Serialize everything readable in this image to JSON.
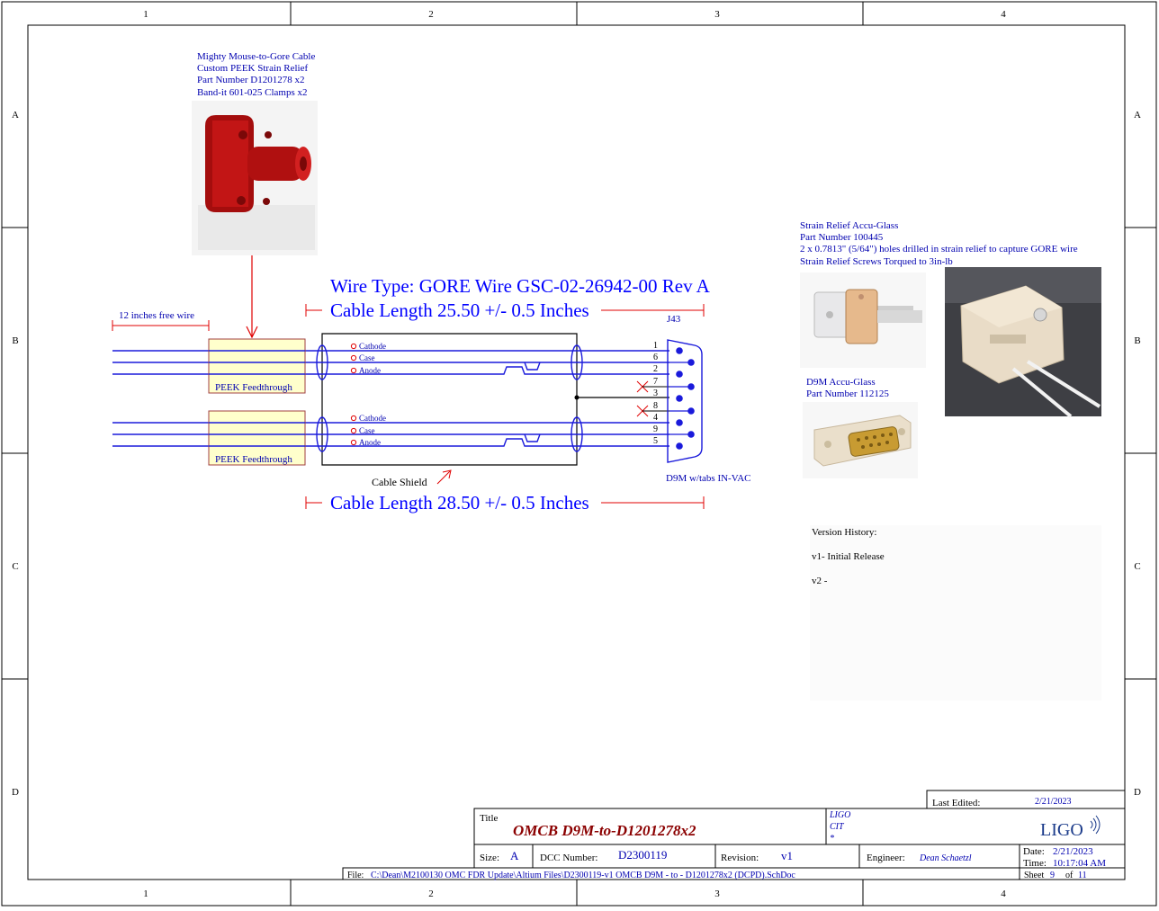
{
  "frame": {
    "columns": [
      "1",
      "2",
      "3",
      "4"
    ],
    "rows": [
      "A",
      "B",
      "C",
      "D"
    ]
  },
  "strain_relief_note": {
    "lines": [
      "Mighty Mouse-to-Gore Cable",
      "Custom PEEK Strain Relief",
      "Part Number D1201278 x2",
      "Band-it 601-025 Clamps x2"
    ]
  },
  "free_wire_label": "12 inches free wire",
  "wire_type": "Wire Type: GORE Wire GSC-02-26942-00 Rev A",
  "cable_length_top": "Cable Length 25.50 +/- 0.5 Inches",
  "cable_length_bottom": "Cable Length 28.50 +/- 0.5 Inches",
  "feedthroughs": [
    {
      "label": "PEEK Feedthrough",
      "wires": [
        "Cathode",
        "Case",
        "Anode"
      ]
    },
    {
      "label": "PEEK Feedthrough",
      "wires": [
        "Cathode",
        "Case",
        "Anode"
      ]
    }
  ],
  "cable_shield_label": "Cable Shield",
  "connector": {
    "ref": "J43",
    "pins": [
      "1",
      "6",
      "2",
      "7",
      "3",
      "8",
      "4",
      "9",
      "5"
    ],
    "name": "D9M w/tabs IN-VAC"
  },
  "accu_glass_note": {
    "lines": [
      "Strain Relief Accu-Glass",
      "Part Number 100445",
      "2 x 0.7813\" (5/64\") holes drilled in strain relief to capture GORE wire",
      "Strain Relief Screws Torqued to 3in-lb"
    ]
  },
  "d9m_note": {
    "lines": [
      "D9M Accu-Glass",
      "Part Number 112125"
    ]
  },
  "version_history": {
    "title": "Version History:",
    "entries": [
      "v1- Initial Release",
      "v2 -"
    ]
  },
  "title_block": {
    "last_edited_label": "Last Edited:",
    "last_edited": "2/21/2023",
    "title_label": "Title",
    "title": "OMCB D9M-to-D1201278x2",
    "org_lines": [
      "LIGO",
      "CIT",
      "*"
    ],
    "logo": "LIGO",
    "size_label": "Size:",
    "size": "A",
    "dcc_label": "DCC Number:",
    "dcc": "D2300119",
    "revision_label": "Revision:",
    "revision": "v1",
    "engineer_label": "Engineer:",
    "engineer": "Dean Schaetzl",
    "date_label": "Date:",
    "date": "2/21/2023",
    "time_label": "Time:",
    "time": "10:17:04 AM",
    "file_label": "File:",
    "file": "C:\\Dean\\M2100130 OMC FDR Update\\Altium Files\\D2300119-v1 OMCB D9M - to - D1201278x2 (DCPD).SchDoc",
    "sheet_label": "Sheet",
    "sheet": "9",
    "of_label": "of",
    "sheet_total": "11"
  },
  "colors": {
    "wire": "#1a1adb",
    "annotation": "#0000b0",
    "red": "#e00000",
    "feedthrough_fill": "#ffffcc",
    "feedthrough_border": "#a04040",
    "title_red": "#8b0000"
  }
}
